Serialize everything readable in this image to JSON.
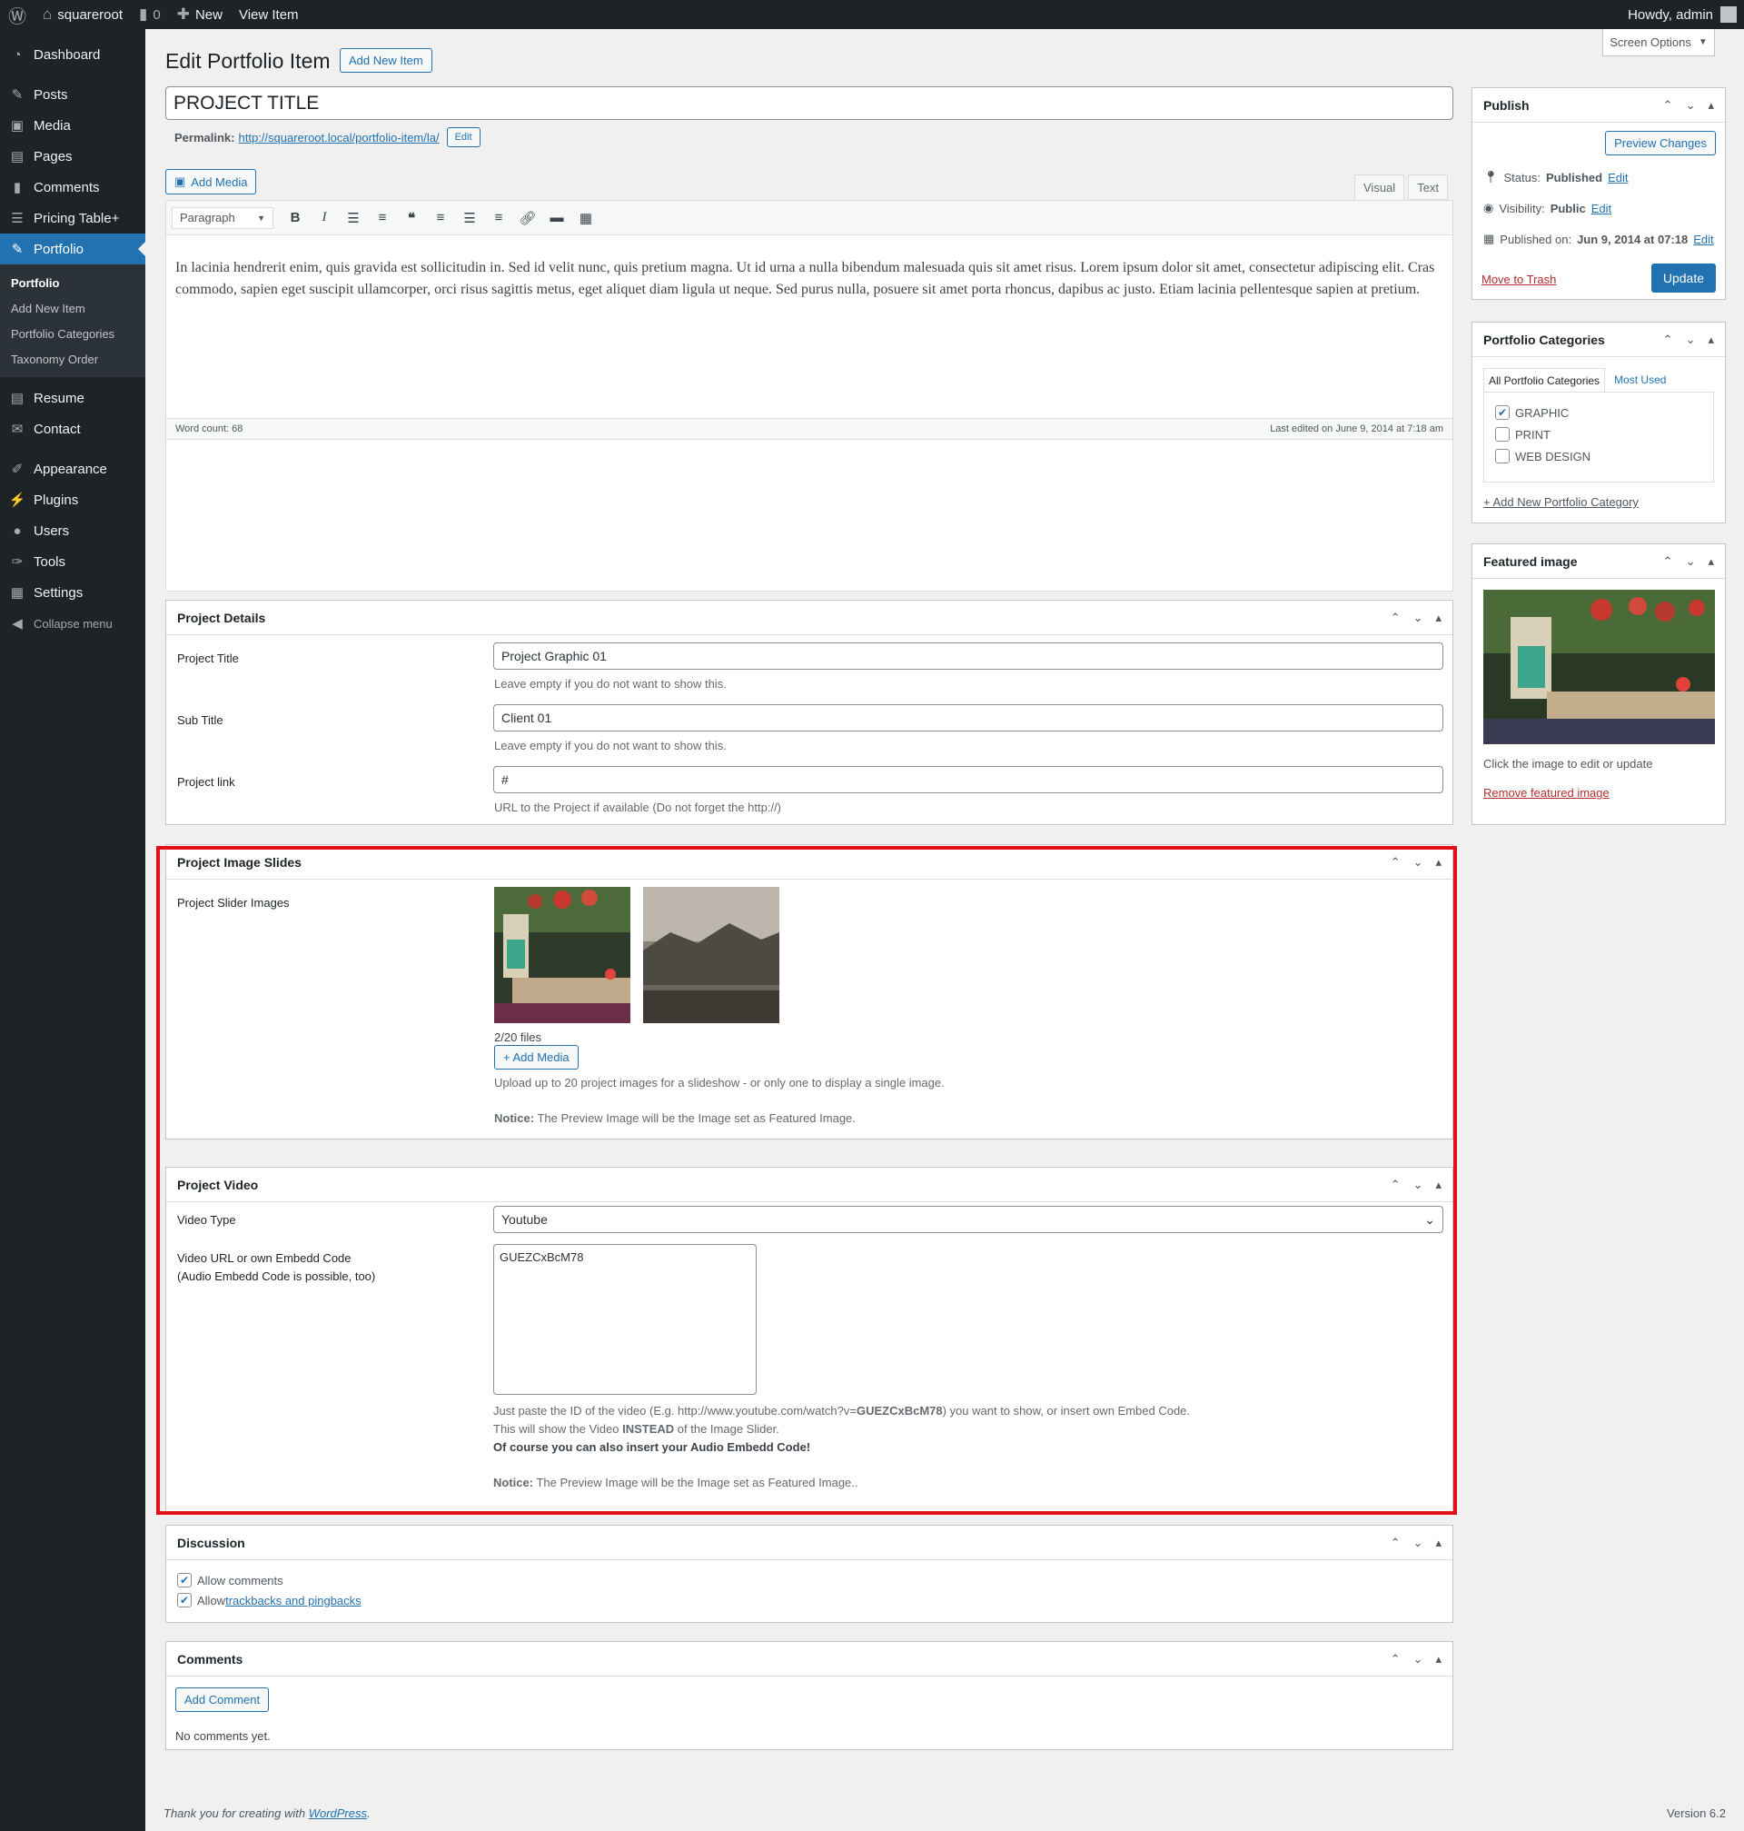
{
  "adminbar": {
    "site_name": "squareroot",
    "comments_count": "0",
    "new_label": "New",
    "view_label": "View Item",
    "howdy": "Howdy, admin"
  },
  "menu": {
    "dashboard": "Dashboard",
    "posts": "Posts",
    "media": "Media",
    "pages": "Pages",
    "comments": "Comments",
    "pricing": "Pricing Table+",
    "portfolio": "Portfolio",
    "sub": {
      "portfolio": "Portfolio",
      "add_new": "Add New Item",
      "categories": "Portfolio Categories",
      "taxonomy": "Taxonomy Order"
    },
    "resume": "Resume",
    "contact": "Contact",
    "appearance": "Appearance",
    "plugins": "Plugins",
    "users": "Users",
    "tools": "Tools",
    "settings": "Settings",
    "collapse": "Collapse menu"
  },
  "header": {
    "title": "Edit Portfolio Item",
    "add_new": "Add New Item",
    "screen_options": "Screen Options"
  },
  "post": {
    "title": "PROJECT TITLE",
    "permalink_label": "Permalink:",
    "permalink_url": "http://squareroot.local/portfolio-item/la/",
    "permalink_edit": "Edit"
  },
  "editor": {
    "add_media": "Add Media",
    "tab_visual": "Visual",
    "tab_text": "Text",
    "format": "Paragraph",
    "content": "In lacinia hendrerit enim, quis gravida est sollicitudin in. Sed id velit nunc, quis pretium magna. Ut id urna a nulla bibendum malesuada quis sit amet risus. Lorem ipsum dolor sit amet, consectetur adipiscing elit. Cras commodo, sapien eget suscipit ullamcorper, orci risus sagittis metus, eget aliquet diam ligula ut neque. Sed purus nulla, posuere sit amet porta rhoncus, dapibus ac justo. Etiam lacinia pellentesque sapien at pretium.",
    "word_count": "Word count: 68",
    "last_edited": "Last edited on June 9, 2014 at 7:18 am"
  },
  "project_details": {
    "title": "Project Details",
    "project_title_label": "Project Title",
    "project_title_value": "Project Graphic 01",
    "project_title_desc": "Leave empty if you do not want to show this.",
    "sub_title_label": "Sub Title",
    "sub_title_value": "Client 01",
    "sub_title_desc": "Leave empty if you do not want to show this.",
    "link_label": "Project link",
    "link_value": "#",
    "link_desc": "URL to the Project if available (Do not forget the http://)"
  },
  "image_slides": {
    "title": "Project Image Slides",
    "label": "Project Slider Images",
    "files": "2/20 files",
    "add_media": "+ Add Media",
    "desc": "Upload up to 20 project images for a slideshow - or only one to display a single image.",
    "notice_bold": "Notice:",
    "notice_text": " The Preview Image will be the Image set as Featured Image."
  },
  "project_video": {
    "title": "Project Video",
    "type_label": "Video Type",
    "type_value": "Youtube",
    "url_label_1": "Video URL or own Embedd Code",
    "url_label_2": "(Audio Embedd Code is possible, too)",
    "url_value": "GUEZCxBcM78",
    "desc_1a": "Just paste the ID of the video (E.g. http://www.youtube.com/watch?v=",
    "desc_1b": "GUEZCxBcM78",
    "desc_1c": ") you want to show, or insert own Embed Code.",
    "desc_2a": "This will show the Video ",
    "desc_2b": "INSTEAD",
    "desc_2c": " of the Image Slider.",
    "desc_3": "Of course you can also insert your Audio Embedd Code!",
    "notice_bold": "Notice:",
    "notice_text": " The Preview Image will be the Image set as Featured Image.."
  },
  "discussion": {
    "title": "Discussion",
    "allow_comments": "Allow comments",
    "allow_prefix": "Allow ",
    "trackbacks": "trackbacks and pingbacks"
  },
  "comments_box": {
    "title": "Comments",
    "add": "Add Comment",
    "none": "No comments yet."
  },
  "publish": {
    "title": "Publish",
    "preview": "Preview Changes",
    "status_label": "Status:",
    "status_value": "Published",
    "visibility_label": "Visibility:",
    "visibility_value": "Public",
    "published_label": "Published on:",
    "published_value": "Jun 9, 2014 at 07:18",
    "edit": "Edit",
    "trash": "Move to Trash",
    "update": "Update"
  },
  "categories": {
    "title": "Portfolio Categories",
    "tab_all": "All Portfolio Categories",
    "tab_used": "Most Used",
    "items": [
      {
        "label": "GRAPHIC",
        "checked": true
      },
      {
        "label": "PRINT",
        "checked": false
      },
      {
        "label": "WEB DESIGN",
        "checked": false
      }
    ],
    "add_new": "+ Add New Portfolio Category"
  },
  "featured": {
    "title": "Featured image",
    "hint": "Click the image to edit or update",
    "remove": "Remove featured image"
  },
  "footer": {
    "thanks": "Thank you for creating with ",
    "wp": "WordPress",
    "period": ".",
    "version": "Version 6.2"
  },
  "colors": {
    "accent": "#2271b1",
    "admin_dark": "#1d2327",
    "highlight": "#e0111b"
  }
}
